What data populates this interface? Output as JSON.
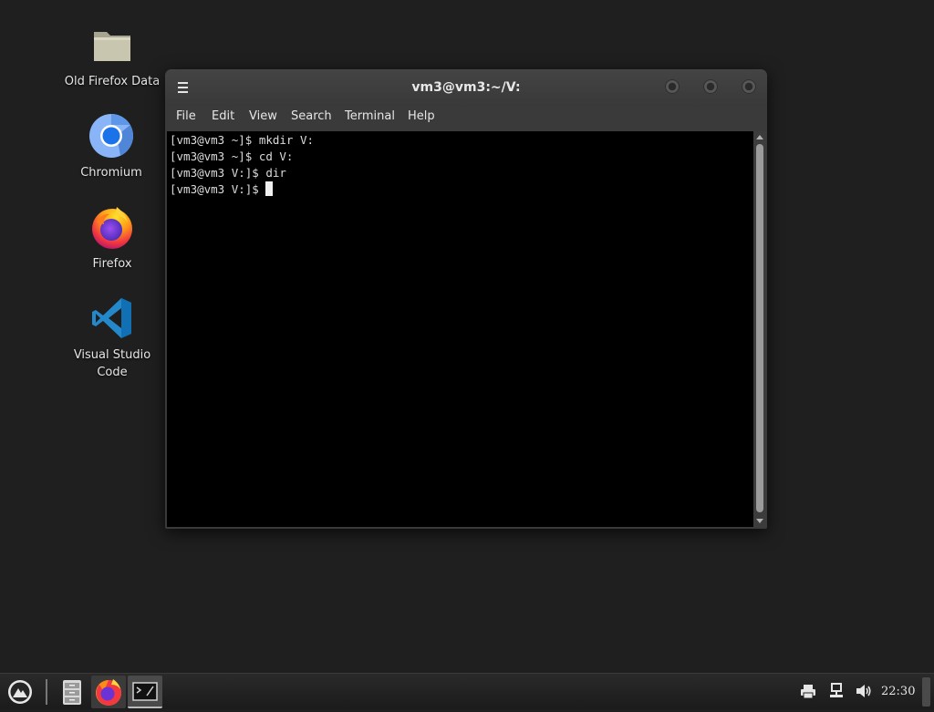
{
  "desktop": {
    "icons": [
      {
        "label": "Old Firefox Data",
        "icon": "folder-icon"
      },
      {
        "label": "Chromium",
        "icon": "chromium-icon"
      },
      {
        "label": "Firefox",
        "icon": "firefox-icon"
      },
      {
        "label": "Visual Studio Code",
        "icon": "vscode-icon"
      }
    ]
  },
  "window": {
    "title": "vm3@vm3:~/V:",
    "menu": [
      "File",
      "Edit",
      "View",
      "Search",
      "Terminal",
      "Help"
    ],
    "terminal_lines": [
      "[vm3@vm3 ~]$ mkdir V:",
      "[vm3@vm3 ~]$ cd V:",
      "[vm3@vm3 V:]$ dir",
      "[vm3@vm3 V:]$ "
    ]
  },
  "taskbar": {
    "clock": "22:30",
    "launchers": [
      "app-menu-icon",
      "file-manager-icon",
      "firefox-icon",
      "terminal-icon"
    ],
    "tray": [
      "printer-icon",
      "network-icon",
      "volume-icon"
    ]
  },
  "colors": {
    "desktop_bg": "#1f1f1f",
    "window_bg": "#3a3a3a",
    "terminal_bg": "#000000",
    "terminal_fg": "#dcdcdc"
  }
}
